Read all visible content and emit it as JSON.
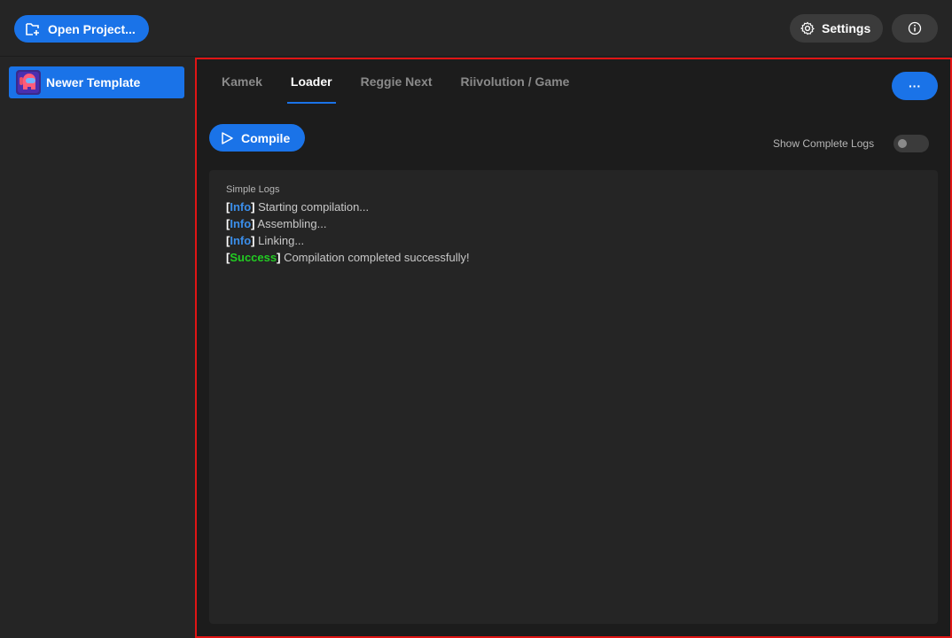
{
  "topbar": {
    "open_project_label": "Open Project...",
    "settings_label": "Settings"
  },
  "sidebar": {
    "items": [
      {
        "label": "Newer Template"
      }
    ]
  },
  "main": {
    "tabs": [
      {
        "label": "Kamek",
        "active": false
      },
      {
        "label": "Loader",
        "active": true
      },
      {
        "label": "Reggie Next",
        "active": false
      },
      {
        "label": "Riivolution / Game",
        "active": false
      }
    ],
    "more_label": "···",
    "compile_label": "Compile",
    "show_complete_logs_label": "Show Complete Logs",
    "show_complete_logs_on": false,
    "logs": {
      "title": "Simple Logs",
      "lines": [
        {
          "tag": "Info",
          "text": " Starting compilation..."
        },
        {
          "tag": "Info",
          "text": " Assembling..."
        },
        {
          "tag": "Info",
          "text": " Linking..."
        },
        {
          "tag": "Success",
          "text": " Compilation completed successfully!"
        }
      ]
    }
  },
  "colors": {
    "accent": "#1a73e8",
    "info": "#3b8eea",
    "success": "#22cc22",
    "highlight_border": "#e01515"
  }
}
